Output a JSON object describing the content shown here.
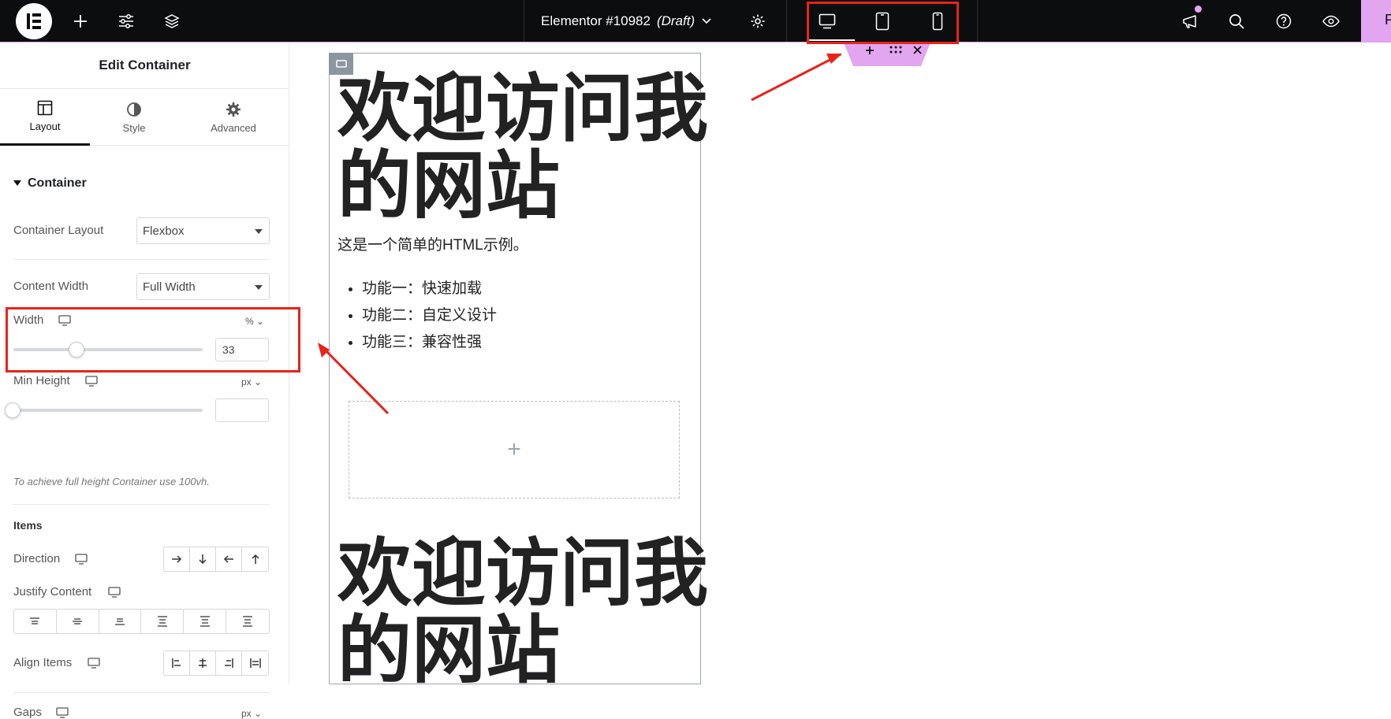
{
  "topbar": {
    "document_name": "Elementor #10982",
    "document_status": "(Draft)",
    "right_tab_letter": "P"
  },
  "panel": {
    "title": "Edit Container",
    "tabs": [
      {
        "label": "Layout",
        "icon": "layout-icon",
        "active": true
      },
      {
        "label": "Style",
        "icon": "half-circle-icon",
        "active": false
      },
      {
        "label": "Advanced",
        "icon": "gear-icon",
        "active": false
      }
    ],
    "section": "Container",
    "container_layout": {
      "label": "Container Layout",
      "value": "Flexbox"
    },
    "content_width": {
      "label": "Content Width",
      "value": "Full Width"
    },
    "width": {
      "label": "Width",
      "unit": "%",
      "value": "33"
    },
    "min_height": {
      "label": "Min Height",
      "unit": "px",
      "value": ""
    },
    "min_height_hint": "To achieve full height Container use 100vh.",
    "items_heading": "Items",
    "direction": {
      "label": "Direction"
    },
    "justify_content": {
      "label": "Justify Content"
    },
    "align_items": {
      "label": "Align Items"
    },
    "gaps": {
      "label": "Gaps",
      "unit": "px"
    }
  },
  "canvas": {
    "heading_line1": "欢迎访问我",
    "heading_line2": "的网站",
    "paragraph": "这是一个简单的HTML示例。",
    "list": [
      "功能一：快速加载",
      "功能二：自定义设计",
      "功能三：兼容性强"
    ],
    "drop_zone_symbol": "+"
  },
  "colors": {
    "topbar_bg": "#0c0d0e",
    "accent_pink": "#e2a5f0",
    "annotation_red": "#e8231a"
  }
}
